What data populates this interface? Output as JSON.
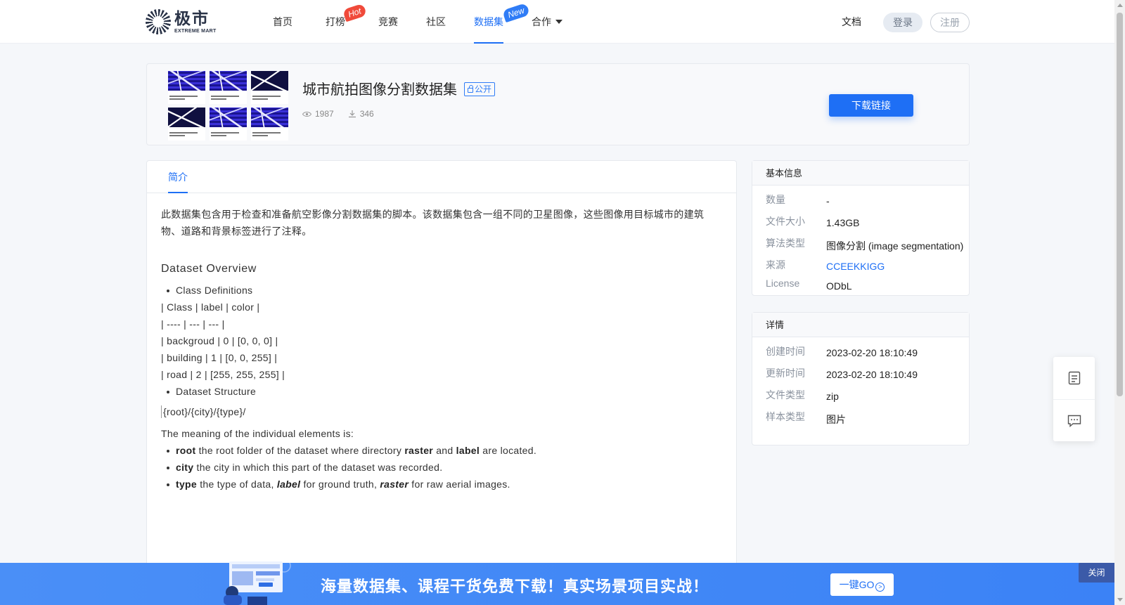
{
  "header": {
    "logo_cn": "极市",
    "logo_en": "EXTREME MART",
    "nav": [
      {
        "label": "首页"
      },
      {
        "label": "打榜",
        "badge": "Hot"
      },
      {
        "label": "竞赛"
      },
      {
        "label": "社区"
      },
      {
        "label": "数据集",
        "badge": "New",
        "active": true
      },
      {
        "label": "合作"
      }
    ],
    "docs": "文档",
    "login": "登录",
    "register": "注册"
  },
  "dataset": {
    "title": "城市航拍图像分割数据集",
    "visibility": "公开",
    "views": "1987",
    "downloads": "346",
    "download_button": "下载链接"
  },
  "tabs": {
    "intro": "简介"
  },
  "content": {
    "intro": "此数据集包含用于检查和准备航空影像分割数据集的脚本。该数据集包含一组不同的卫星图像，这些图像用目标城市的建筑物、道路和背景标签进行了注释。",
    "overview_title": "Dataset Overview",
    "bullet_class_definitions": "Class Definitions",
    "table_lines": [
      "| Class | label | color |",
      "| ---- | --- | --- |",
      "| backgroud | 0 | [0, 0, 0] |",
      "| building | 1 | [0, 0, 255] |",
      "| road | 2 | [255, 255, 255] |"
    ],
    "bullet_structure": "Dataset Structure",
    "code_path": "{root}/{city}/{type}/",
    "meaning": "The meaning of the individual elements is:",
    "elements": {
      "root_key": "root",
      "root_text_a": " the root folder of the dataset where directory ",
      "root_raster": "raster",
      "root_and": " and ",
      "root_label": "label",
      "root_text_b": " are located.",
      "city_key": "city",
      "city_text": " the city in which this part of the dataset was recorded.",
      "type_key": "type",
      "type_text_a": " the type of data, ",
      "type_label": "label",
      "type_text_b": " for ground truth, ",
      "type_raster": "raster",
      "type_text_c": " for raw aerial images."
    }
  },
  "basic_info": {
    "title": "基本信息",
    "rows": [
      {
        "key": "数量",
        "value": "-"
      },
      {
        "key": "文件大小",
        "value": "1.43GB"
      },
      {
        "key": "算法类型",
        "value": "图像分割 (image segmentation)"
      },
      {
        "key": "来源",
        "value": "CCEEKKIGG"
      },
      {
        "key": "License",
        "value": "ODbL"
      }
    ]
  },
  "details": {
    "title": "详情",
    "rows": [
      {
        "key": "创建时间",
        "value": "2023-02-20 18:10:49"
      },
      {
        "key": "更新时间",
        "value": "2023-02-20 18:10:49"
      },
      {
        "key": "文件类型",
        "value": "zip"
      },
      {
        "key": "样本类型",
        "value": "图片"
      }
    ]
  },
  "float_tools": [
    "notes-icon",
    "message-icon"
  ],
  "banner": {
    "text": "海量数据集、课程干货免费下载！真实场景项目实战！",
    "button": "一键GO",
    "close": "关闭"
  },
  "colors": {
    "accent": "#1e6ff5",
    "hot_badge": "#f04a3a",
    "banner": "#4a8ff7"
  }
}
